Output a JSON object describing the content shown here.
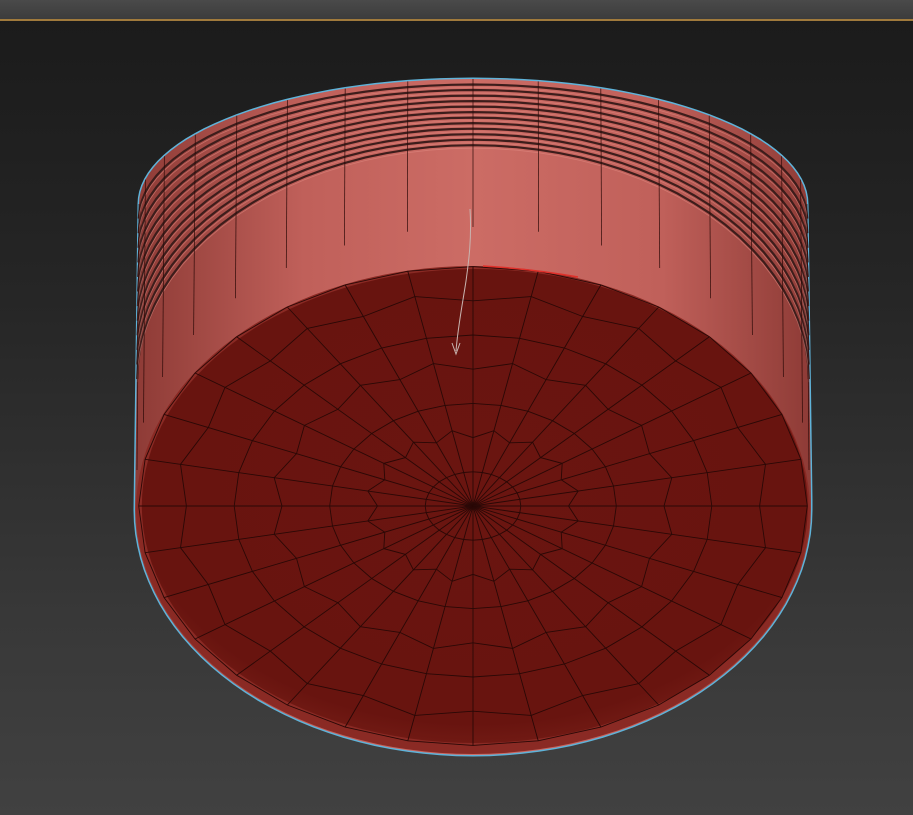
{
  "viewport": {
    "object": {
      "type": "cylinder",
      "radial_segments": 32,
      "cap_rings": 7,
      "height_segments": 12,
      "selected": true,
      "render_mode": "edged-faces"
    }
  },
  "colors": {
    "background_top": "#1b1b1b",
    "background_bottom": "#414141",
    "titlebar": "#3f3f3f",
    "titlebar_accent": "#a07a3c",
    "side_face": "#c96a63",
    "side_face_dark": "#9a4540",
    "side_band_line": "#3d1d1b",
    "cap_face": "#6b1511",
    "cap_highlight": "#8a2a24",
    "wire": "#2a0806",
    "selection_outline": "#5fb3d9",
    "gizmo_arrow": "#c8b4b0"
  }
}
